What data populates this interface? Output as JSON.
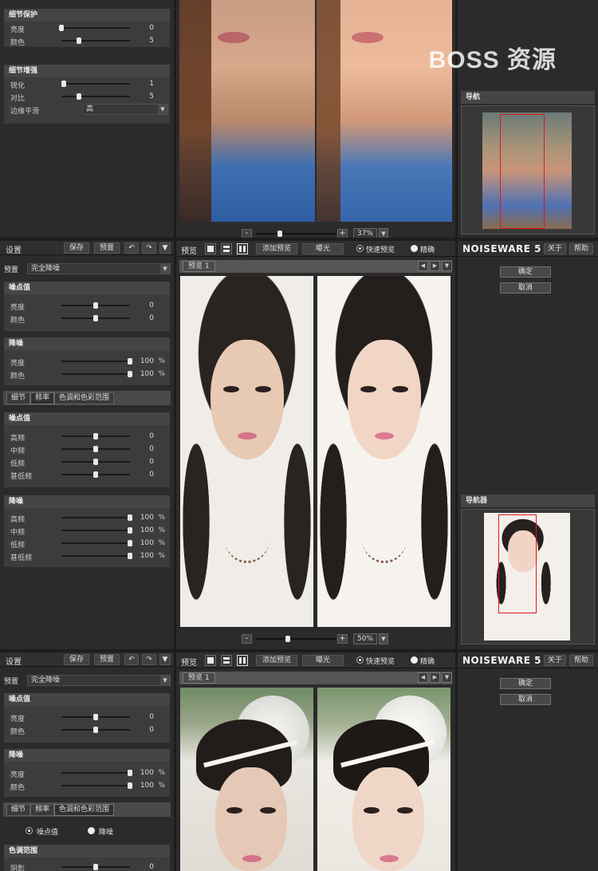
{
  "watermark": "BOSS 资源",
  "section1": {
    "left": {
      "groups": [
        {
          "title": "细节保护",
          "rows": [
            {
              "label": "亮度",
              "value": "0",
              "level": 0.0
            },
            {
              "label": "颜色",
              "value": "5",
              "level": 0.25
            }
          ]
        },
        {
          "title": "细节增强",
          "rows": [
            {
              "label": "锐化",
              "value": "1",
              "level": 0.03
            },
            {
              "label": "对比",
              "value": "5",
              "level": 0.25
            }
          ]
        }
      ],
      "edge": {
        "label": "边缘平滑",
        "value": "高"
      }
    },
    "center": {
      "zoom": "37%",
      "zoom_level": 0.3
    },
    "right": {
      "nav_title": "导航"
    }
  },
  "panels": [
    {
      "left": {
        "title": "设置",
        "save": "保存",
        "preset_btn": "预置",
        "undo_icon": "undo-icon",
        "redo_icon": "redo-icon",
        "preset_label": "预置",
        "preset_value": "完全降噪",
        "noise_level": {
          "title": "噪点值",
          "rows": [
            {
              "label": "亮度",
              "value": "0",
              "level": 0.5
            },
            {
              "label": "颜色",
              "value": "0",
              "level": 0.5
            }
          ]
        },
        "noise_reduction": {
          "title": "降噪",
          "rows": [
            {
              "label": "亮度",
              "value": "100",
              "unit": "%",
              "level": 1.0
            },
            {
              "label": "颜色",
              "value": "100",
              "unit": "%",
              "level": 1.0
            }
          ]
        },
        "tabs": [
          "细节",
          "频率",
          "色调和色彩范围"
        ],
        "active_tab": 1,
        "freq_noise": {
          "title": "噪点值",
          "rows": [
            {
              "label": "高频",
              "value": "0",
              "level": 0.5
            },
            {
              "label": "中频",
              "value": "0",
              "level": 0.5
            },
            {
              "label": "低频",
              "value": "0",
              "level": 0.5
            },
            {
              "label": "甚低频",
              "value": "0",
              "level": 0.5
            }
          ]
        },
        "freq_reduction": {
          "title": "降噪",
          "rows": [
            {
              "label": "高频",
              "value": "100",
              "unit": "%",
              "level": 1.0
            },
            {
              "label": "中频",
              "value": "100",
              "unit": "%",
              "level": 1.0
            },
            {
              "label": "低频",
              "value": "100",
              "unit": "%",
              "level": 1.0
            },
            {
              "label": "甚低频",
              "value": "100",
              "unit": "%",
              "level": 1.0
            }
          ]
        }
      },
      "center": {
        "preview_label": "预览",
        "add_preview": "添加预览",
        "exposure": "曝光",
        "quick_preview": "快速预览",
        "accurate": "精确",
        "tab": "预览 1",
        "zoom": "50%",
        "zoom_level": 0.4
      },
      "right": {
        "brand": "NOISEWARE 5",
        "about": "关于",
        "help": "帮助",
        "ok": "确定",
        "cancel": "取消",
        "nav_title": "导航器"
      }
    },
    {
      "left": {
        "title": "设置",
        "save": "保存",
        "preset_btn": "预置",
        "preset_label": "预置",
        "preset_value": "完全降噪",
        "noise_level": {
          "title": "噪点值",
          "rows": [
            {
              "label": "亮度",
              "value": "0",
              "level": 0.5
            },
            {
              "label": "颜色",
              "value": "0",
              "level": 0.5
            }
          ]
        },
        "noise_reduction": {
          "title": "降噪",
          "rows": [
            {
              "label": "亮度",
              "value": "100",
              "unit": "%",
              "level": 1.0
            },
            {
              "label": "颜色",
              "value": "100",
              "unit": "%",
              "level": 1.0
            }
          ]
        },
        "tabs": [
          "细节",
          "频率",
          "色调和色彩范围"
        ],
        "active_tab": 2,
        "radio_noise": "噪点值",
        "radio_reduce": "降噪",
        "tone_title": "色调范围",
        "tone_row": {
          "label": "阴影",
          "value": "0"
        }
      },
      "center": {
        "preview_label": "预览",
        "add_preview": "添加预览",
        "exposure": "曝光",
        "quick_preview": "快速预览",
        "accurate": "精确",
        "tab": "预览 1"
      },
      "right": {
        "brand": "NOISEWARE 5",
        "about": "关于",
        "help": "帮助",
        "ok": "确定",
        "cancel": "取消"
      }
    }
  ]
}
